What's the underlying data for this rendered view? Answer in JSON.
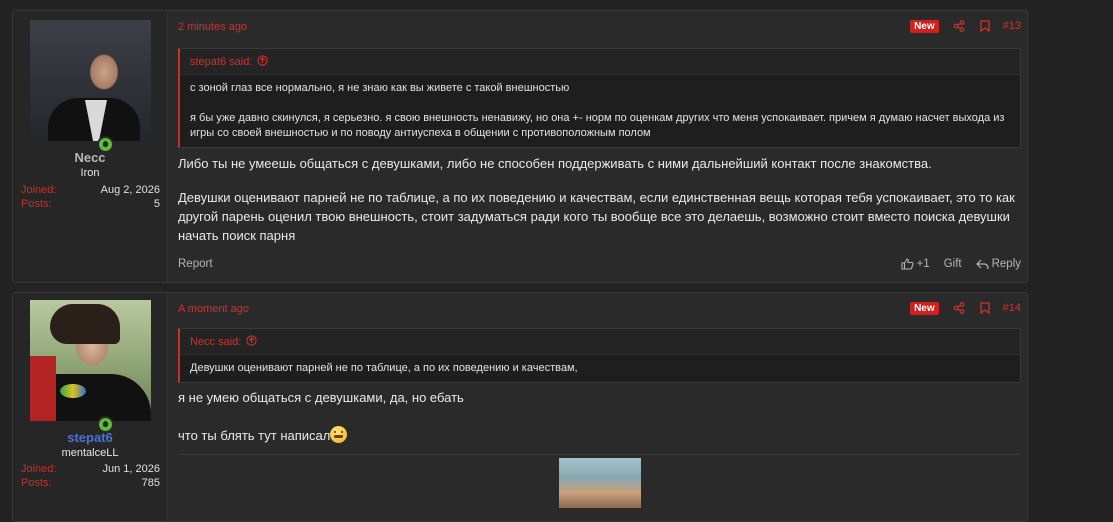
{
  "posts": [
    {
      "time": "2 minutes ago",
      "badge": "New",
      "number": "#13",
      "user": {
        "name": "Necc",
        "name_color": "#b8b8b8",
        "title": "Iron",
        "joined_label": "Joined:",
        "joined": "Aug 2, 2026",
        "posts_label": "Posts:",
        "posts": "5"
      },
      "quote": {
        "author": "stepat6 said:",
        "lines": [
          "с зоной глаз все нормально, я не знаю как вы живете с такой внешностью",
          "я бы уже давно скинулся, я серьезно. я свою внешность ненавижу, но она +- норм по оценкам других что меня успокаивает. причем я думаю насчет выхода из игры со своей внешностью и по поводу антиуспеха в общении с противоположным полом"
        ]
      },
      "paragraphs": [
        "Либо ты не умеешь общаться с девушками, либо не способен поддерживать с ними дальнейший контакт после знакомства.",
        "Девушки оценивают парней не по таблице, а по их поведению и качествам, если единственная вещь которая тебя успокаивает, это то как другой парень оценил твою внешность, стоит задуматься ради кого ты вообще все это делаешь, возможно стоит вместо поиска девушки начать поиск парня"
      ],
      "footer": {
        "report": "Report",
        "like_count": "+1",
        "gift": "Gift",
        "reply": "Reply"
      }
    },
    {
      "time": "A moment ago",
      "badge": "New",
      "number": "#14",
      "user": {
        "name": "stepat6",
        "name_color": "#4b72d8",
        "title": "mentalceLL",
        "joined_label": "Joined:",
        "joined": "Jun 1, 2026",
        "posts_label": "Posts:",
        "posts": "785"
      },
      "quote": {
        "author": "Necc said:",
        "lines": [
          "Девушки оценивают парней не по таблице, а по их поведению и качествам,"
        ]
      },
      "paragraphs": [
        "я не умею общаться с девушками, да, но ебать",
        "что ты блять тут написал"
      ]
    }
  ],
  "colors": {
    "accent": "#d1322b",
    "online": "#5dbb3c",
    "badge": "#d21f1f"
  },
  "icons": [
    "share-icon",
    "bookmark-icon",
    "quote-arrow-icon",
    "online-user-icon",
    "like-icon",
    "reply-icon",
    "grimace-emoji-icon"
  ]
}
